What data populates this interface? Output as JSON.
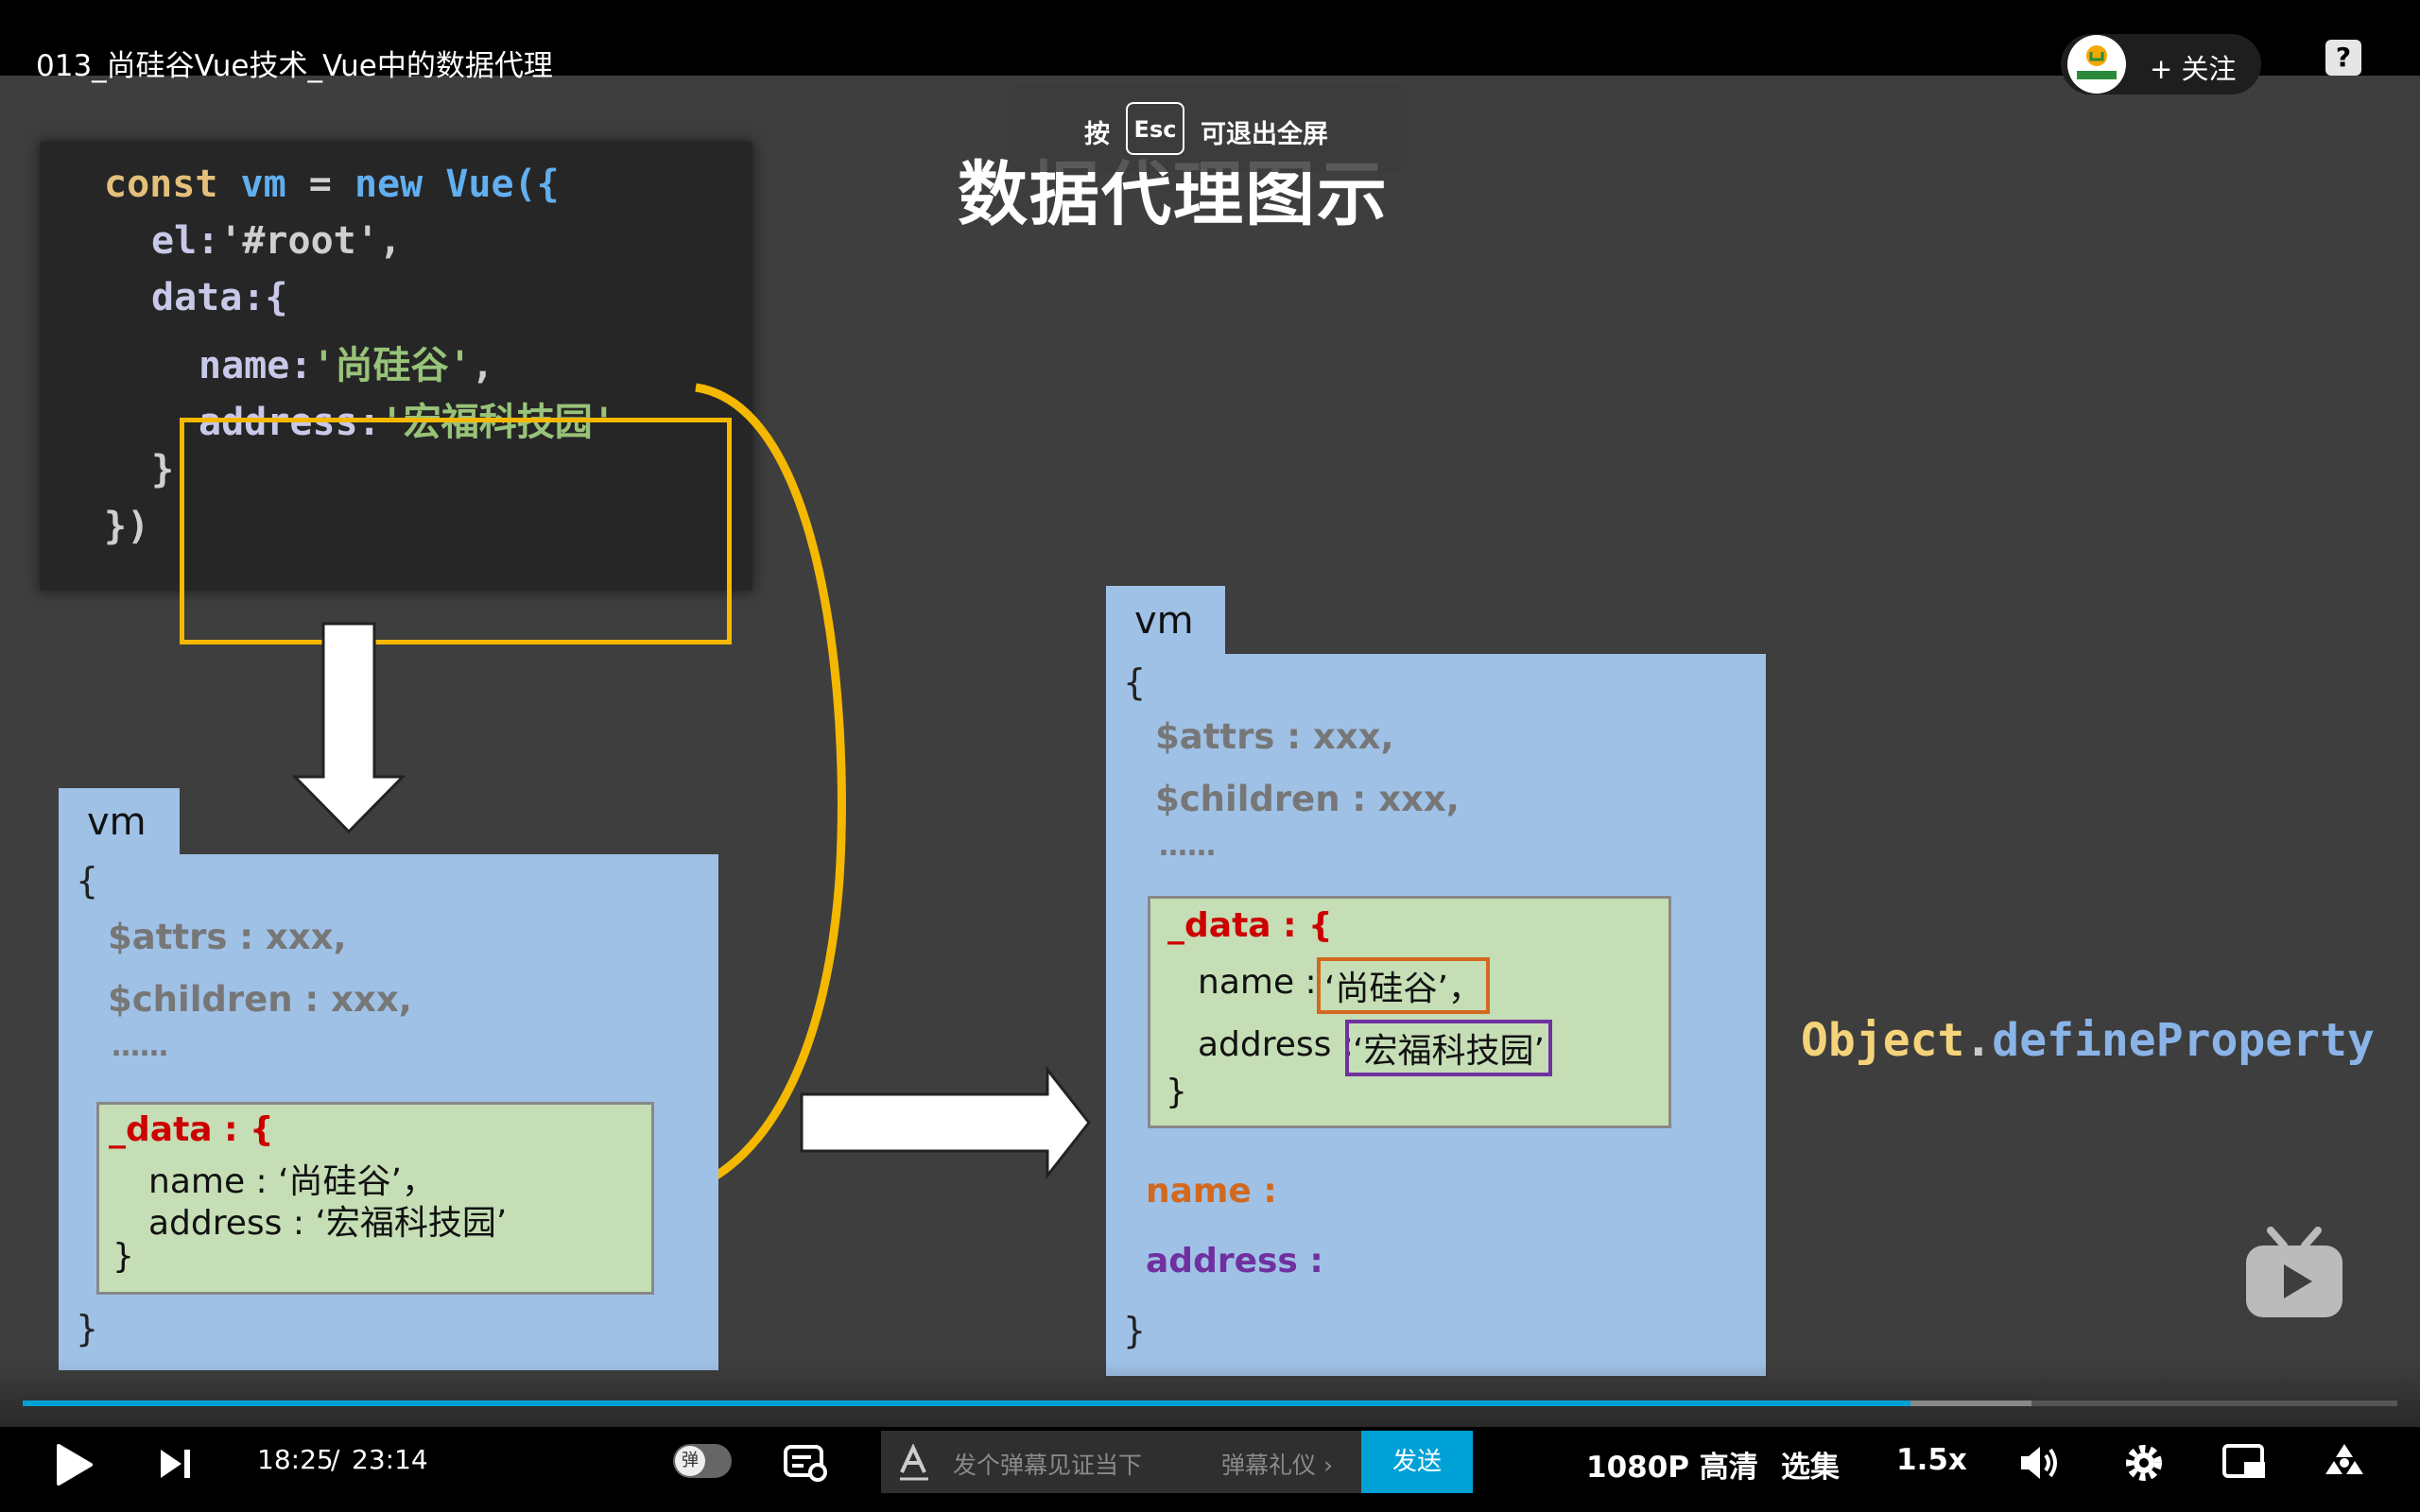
{
  "header": {
    "title": "013_尚硅谷Vue技术_Vue中的数据代理",
    "follow_label": "+ 关注",
    "help_icon": "?"
  },
  "fullscreen_hint": {
    "prefix": "按",
    "key": "Esc",
    "suffix": "可退出全屏"
  },
  "slide": {
    "title": "数据代理图示",
    "code": {
      "line1": [
        "const",
        "vm",
        "=",
        "new",
        "Vue({"
      ],
      "line2": [
        "el:",
        "'#root'",
        ","
      ],
      "line3": "data:{",
      "line4": [
        "name:",
        "'尚硅谷'",
        ","
      ],
      "line5": [
        "address:",
        "'宏福科技园'"
      ],
      "line6": "}",
      "line7": "})"
    },
    "vm_left": {
      "tab": "vm",
      "open_brace": "{",
      "attrs": "$attrs : xxx,",
      "children": "$children : xxx,",
      "ellipsis": "……",
      "data_key": "_data : {",
      "name_line": "name : ‘尚硅谷’，",
      "address_line": "address : ‘宏福科技园’",
      "inner_close": "}",
      "close_brace": "}"
    },
    "vm_right": {
      "tab": "vm",
      "open_brace": "{",
      "attrs": "$attrs : xxx,",
      "children": "$children : xxx,",
      "ellipsis": "……",
      "data_key": "_data : {",
      "name_key": "name : ",
      "name_val": "‘尚硅谷’，",
      "address_key": "address : ",
      "address_val": "‘宏福科技园’",
      "inner_close": "}",
      "proxy_name": "name :",
      "proxy_address": "address :",
      "close_brace": "}"
    },
    "define_property": {
      "object": "Object",
      "dot": ".",
      "method": "defineProperty"
    }
  },
  "controls": {
    "current_time": "18:25",
    "separator": "/",
    "total_time": "23:14",
    "progress": 0.795,
    "buffered": 0.846,
    "danmaku_toggle": "弹",
    "danmaku_placeholder": "发个弹幕见证当下",
    "danmaku_etiquette": "弹幕礼仪 ›",
    "send": "发送",
    "quality": "1080P 高清",
    "episodes": "选集",
    "speed": "1.5x"
  },
  "colors": {
    "brand_blue": "#00a1d6",
    "highlight_yellow": "#f5b800",
    "name_orange": "#d2691e",
    "address_purple": "#7030a0",
    "vm_blue": "#9fc1e6",
    "data_green": "#c5deb5"
  },
  "icons": [
    "help-icon",
    "play-icon",
    "next-icon",
    "danmaku-toggle-icon",
    "danmaku-settings-icon",
    "text-style-icon",
    "volume-icon",
    "settings-icon",
    "pip-icon",
    "fullscreen-icon",
    "bilibili-tv-icon",
    "uploader-avatar"
  ]
}
